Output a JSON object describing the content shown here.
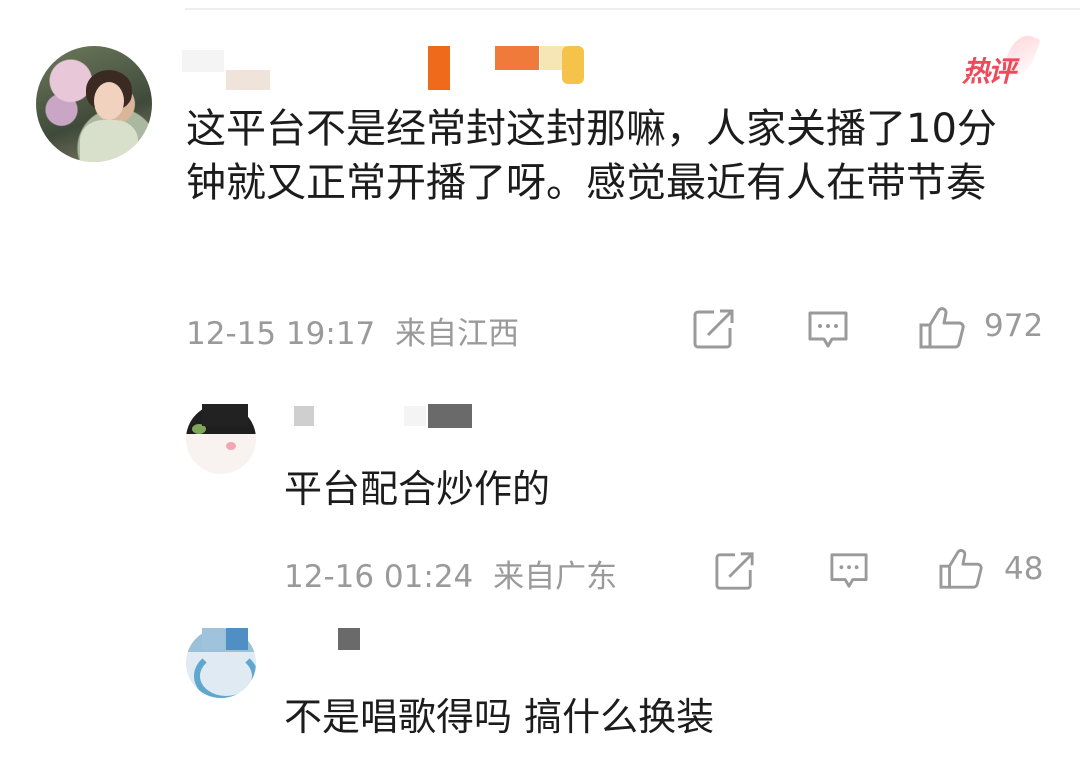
{
  "comments": {
    "main": {
      "hot_badge": "热评",
      "text": "这平台不是经常封这封那嘛，人家关播了10分钟就又正常开播了呀。感觉最近有人在带节奏",
      "time": "12-15 19:17",
      "location": "来自江西",
      "likes": "972"
    },
    "reply1": {
      "text": "平台配合炒作的",
      "time": "12-16 01:24",
      "location": "来自广东",
      "likes": "48"
    },
    "reply2": {
      "text": "不是唱歌得吗 搞什么换装"
    }
  },
  "icons": {
    "share": "share-icon",
    "comment": "comment-icon",
    "like": "thumbs-up-icon"
  },
  "colors": {
    "hot_badge": "#ee4b5a",
    "meta_text": "#9a9a9a",
    "body_text": "#1c1c1c"
  }
}
